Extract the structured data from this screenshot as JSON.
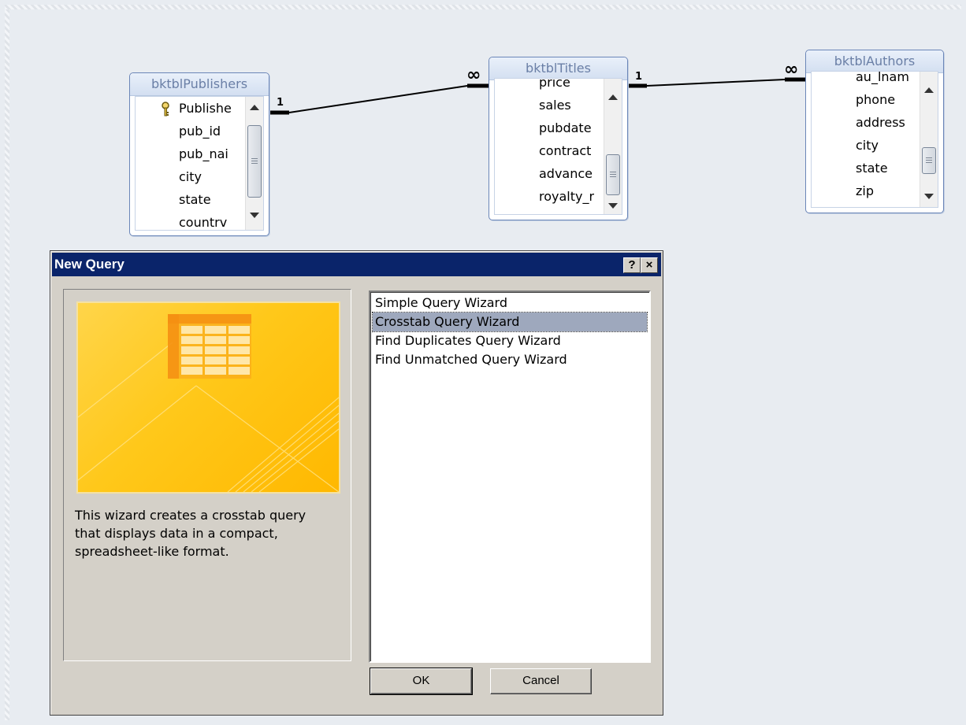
{
  "tables": [
    {
      "name": "bktblPublishers",
      "fields": [
        "Publishe",
        "pub_id",
        "pub_nai",
        "city",
        "state",
        "countrv"
      ],
      "key_field_index": 0
    },
    {
      "name": "bktblTitles",
      "fields": [
        "price",
        "sales",
        "pubdate",
        "contract",
        "advance",
        "royalty_r"
      ]
    },
    {
      "name": "bktblAuthors",
      "fields": [
        "au_lnam",
        "phone",
        "address",
        "city",
        "state",
        "zip"
      ]
    }
  ],
  "relationships": [
    {
      "from": "bktblPublishers",
      "to": "bktblTitles",
      "from_label": "1",
      "to_label": "∞"
    },
    {
      "from": "bktblTitles",
      "to": "bktblAuthors",
      "from_label": "1",
      "to_label": "∞"
    }
  ],
  "dialog": {
    "title": "New Query",
    "help_button": "?",
    "close_button": "×",
    "description": "This wizard creates a crosstab query that displays data in a compact, spreadsheet-like format.",
    "options": [
      "Simple Query Wizard",
      "Crosstab Query Wizard",
      "Find Duplicates Query Wizard",
      "Find Unmatched Query Wizard"
    ],
    "selected_index": 1,
    "ok_label": "OK",
    "cancel_label": "Cancel"
  },
  "colors": {
    "titlebar": "#0a246a",
    "selection": "#9ea8bd",
    "table_border": "#6b86b8",
    "preview_yellow": "#ffc81a"
  }
}
